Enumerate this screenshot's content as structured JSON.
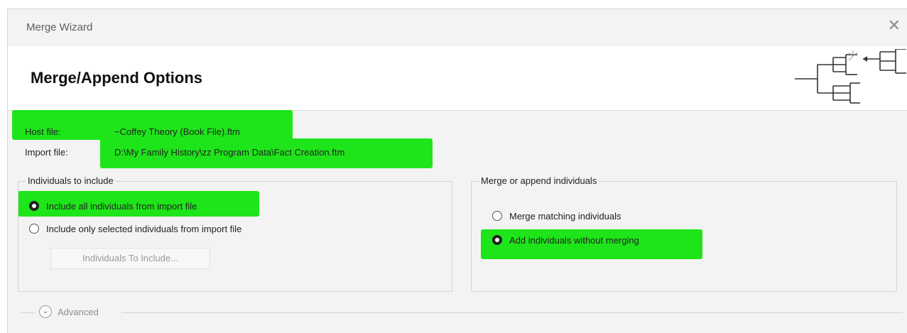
{
  "window": {
    "title": "Merge Wizard",
    "close_icon": "close-icon"
  },
  "header": {
    "title": "Merge/Append Options",
    "logo_icon": "family-tree-icon"
  },
  "files": {
    "host_label": "Host file:",
    "host_value": "~Coffey Theory (Book File).ftm",
    "import_label": "Import file:",
    "import_value": "D:\\My Family History\\zz Program Data\\Fact Creation.ftm"
  },
  "individuals_group": {
    "legend": "Individuals to include",
    "options": [
      {
        "label": "Include all individuals from import file",
        "selected": true
      },
      {
        "label": "Include only selected individuals from import file",
        "selected": false
      }
    ],
    "button_label": "Individuals To Include..."
  },
  "merge_group": {
    "legend": "Merge or append individuals",
    "options": [
      {
        "label": "Merge matching individuals",
        "selected": false
      },
      {
        "label": "Add individuals without merging",
        "selected": true
      }
    ]
  },
  "advanced": {
    "label": "Advanced",
    "icon": "chevron-down-icon"
  },
  "colors": {
    "highlight": "#1ee51a",
    "dialog_bg": "#f3f3f3",
    "header_bg": "#ffffff"
  }
}
